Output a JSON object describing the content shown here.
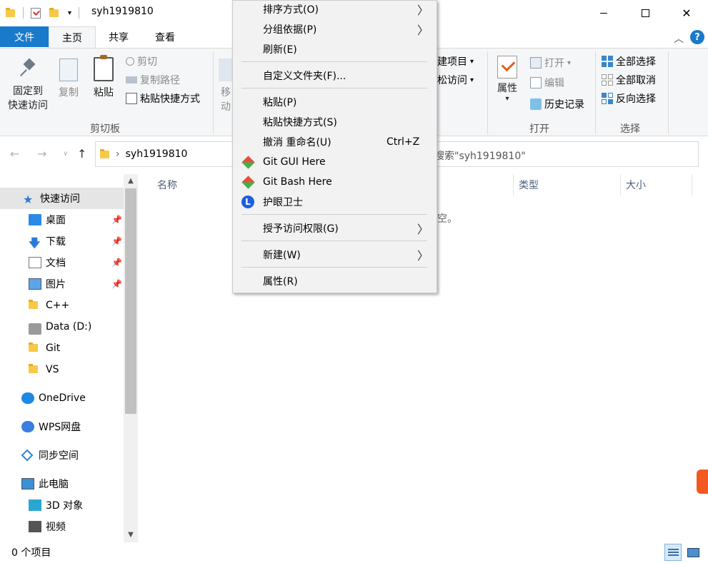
{
  "window": {
    "title": "syh1919810"
  },
  "ribbon_tabs": {
    "file": "文件",
    "home": "主页",
    "share": "共享",
    "view": "查看"
  },
  "clipboard": {
    "pin": "固定到\n快速访问",
    "pin_line1": "固定到",
    "pin_line2": "快速访问",
    "copy": "复制",
    "paste": "粘贴",
    "cut": "剪切",
    "copy_path": "复制路径",
    "paste_shortcut": "粘贴快捷方式",
    "group": "剪切板",
    "move_partial": "移动"
  },
  "new_group": {
    "new_item_partial": "建项目",
    "easy_access_partial": "松访问"
  },
  "open_group": {
    "properties": "属性",
    "open": "打开",
    "edit": "编辑",
    "history": "历史记录",
    "group": "打开"
  },
  "select_group": {
    "select_all": "全部选择",
    "select_none": "全部取消",
    "invert": "反向选择",
    "group": "选择"
  },
  "address": {
    "path": "syh1919810",
    "search_partial": "搜索\"syh1919810\""
  },
  "sidebar": {
    "items": [
      {
        "label": "快速访问"
      },
      {
        "label": "桌面"
      },
      {
        "label": "下载"
      },
      {
        "label": "文档"
      },
      {
        "label": "图片"
      },
      {
        "label": "C++"
      },
      {
        "label": "Data (D:)"
      },
      {
        "label": "Git"
      },
      {
        "label": "VS"
      },
      {
        "label": "OneDrive"
      },
      {
        "label": "WPS网盘"
      },
      {
        "label": "同步空间"
      },
      {
        "label": "此电脑"
      },
      {
        "label": "3D 对象"
      },
      {
        "label": "视频"
      }
    ]
  },
  "columns": {
    "name": "名称",
    "type": "类型",
    "size": "大小"
  },
  "content": {
    "empty_partial": "为空。"
  },
  "status": {
    "count": "0 个项目"
  },
  "context_menu": {
    "items": [
      {
        "label": "排序方式(O)"
      },
      {
        "label": "分组依据(P)"
      },
      {
        "label": "刷新(E)"
      },
      {
        "label": "自定义文件夹(F)..."
      },
      {
        "label": "粘贴(P)"
      },
      {
        "label": "粘贴快捷方式(S)"
      },
      {
        "label": "撤消 重命名(U)",
        "shortcut": "Ctrl+Z"
      },
      {
        "label": "Git GUI Here"
      },
      {
        "label": "Git Bash Here"
      },
      {
        "label": "护眼卫士"
      },
      {
        "label": "授予访问权限(G)"
      },
      {
        "label": "新建(W)"
      },
      {
        "label": "属性(R)"
      }
    ]
  },
  "colors": {
    "accent": "#1979ca",
    "selected_bg": "#e5e5e5",
    "menu_bg": "#f2f2f2"
  }
}
